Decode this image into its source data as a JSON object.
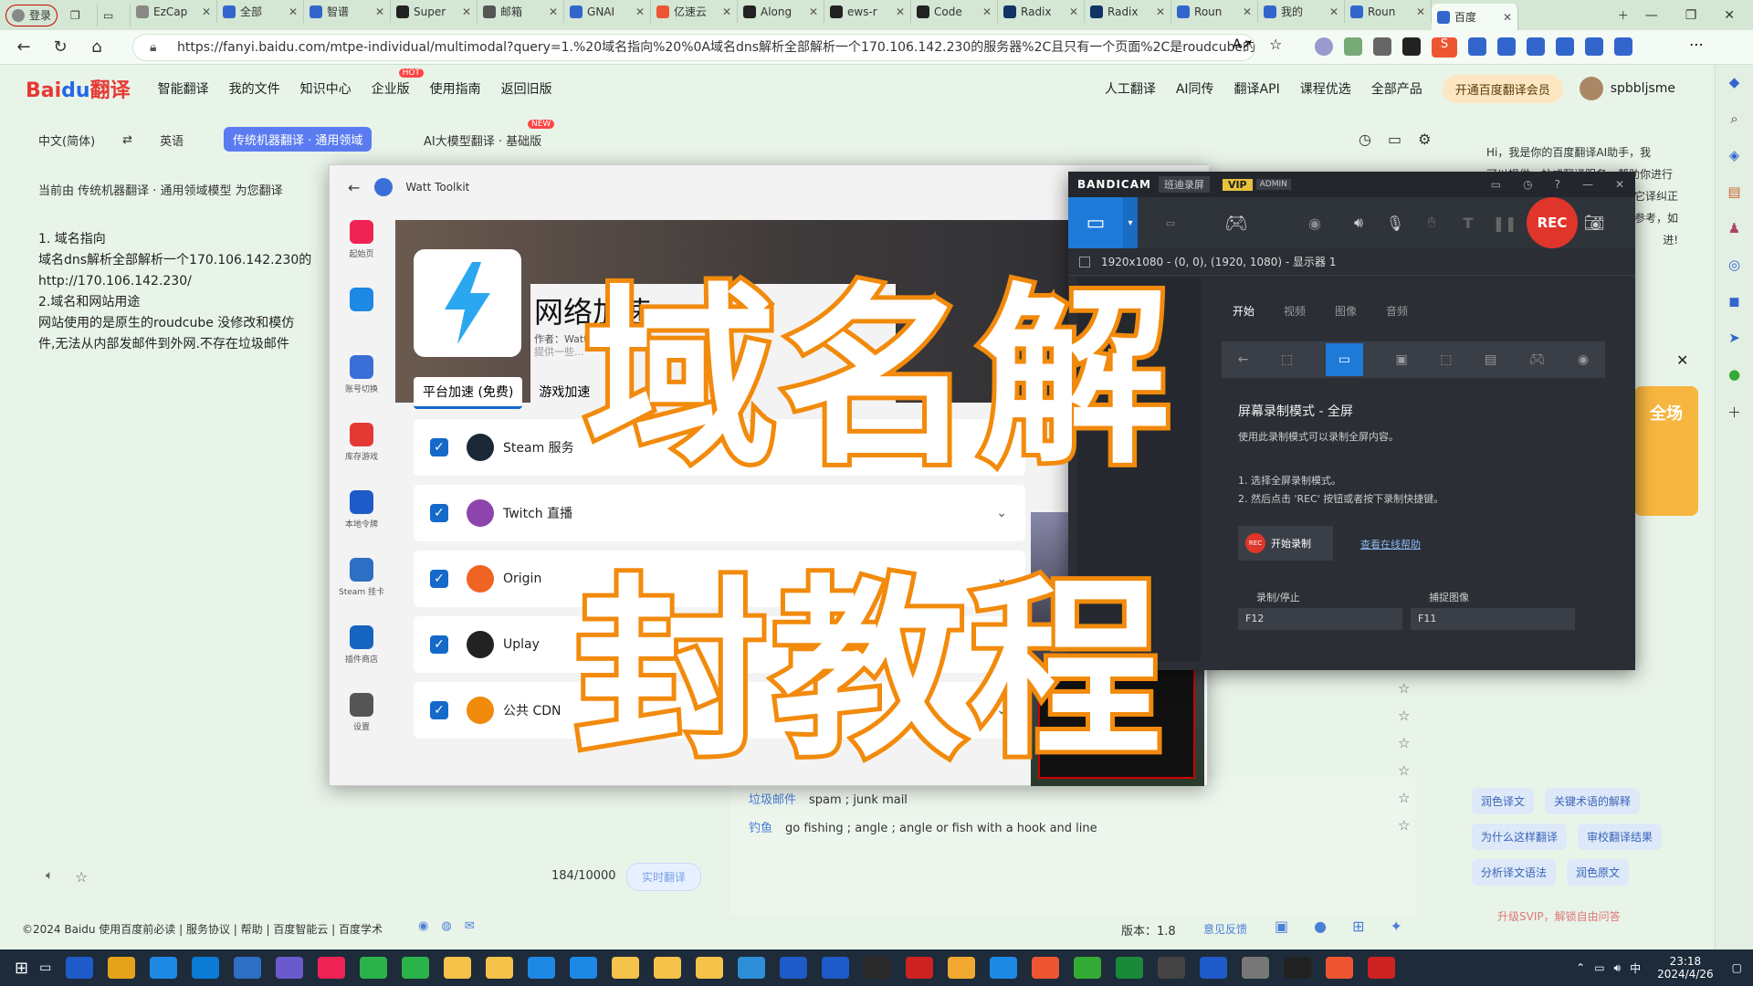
{
  "browser": {
    "login_label": "登录",
    "tabs": [
      "EzCap",
      "全部",
      "智谱",
      "Super",
      "邮箱",
      "GNAI",
      "亿速云",
      "Along",
      "ews-r",
      "Code",
      "Radix",
      "Radix",
      "Roun",
      "我的",
      "Roun",
      "百度"
    ],
    "url": "https://fanyi.baidu.com/mtpe-individual/multimodal?query=1.%20域名指向%20%0A域名dns解析全部解析一个170.106.142.230的服务器%2C且只有一个页面%2C是roudcube的邮箱页面..."
  },
  "baidu": {
    "logo_a": "Bai",
    "logo_b": "du",
    "logo_c": "翻译",
    "nav": [
      "智能翻译",
      "我的文件",
      "知识中心",
      "企业版",
      "使用指南",
      "返回旧版"
    ],
    "hot_badge": "HOT",
    "new_badge": "NEW",
    "nav_right": [
      "人工翻译",
      "AI同传",
      "翻译API",
      "课程优选",
      "全部产品"
    ],
    "vip_btn": "开通百度翻译会员",
    "username": "spbbljsme",
    "src_lang": "中文(简体)",
    "tgt_lang": "英语",
    "mode_active": "传统机器翻译 · 通用领域",
    "mode_ai": "AI大模型翻译 · 基础版",
    "current_model": "当前由 传统机器翻译 · 通用领域模型 为您翻译",
    "source_text": [
      "1. 域名指向",
      "域名dns解析全部解析一个170.106.142.230的",
      "http://170.106.142.230/",
      "2.域名和网站用途",
      "网站使用的是原生的roudcube 没修改和模仿",
      "件,无法从内部发邮件到外网.不存在垃圾邮件"
    ],
    "char_count": "184/10000",
    "realtime_btn": "实时翻译",
    "dict": [
      {
        "term": "垃圾邮件",
        "def": "spam ; junk mail"
      },
      {
        "term": "钓鱼",
        "def": "go fishing ; angle ; angle or fish with a hook and line"
      }
    ],
    "assistant_text": [
      "Hi，我是你的百度翻译AI助手，我",
      "可以提供一站式翻译服务，帮助你进行",
      "它译纠正",
      "参考，如",
      "进!"
    ],
    "side_chips": [
      "润色译文",
      "关键术语的解释",
      "为什么这样翻译",
      "审校翻译结果",
      "分析译文语法",
      "润色原文"
    ],
    "footer_left": "©2024 Baidu  使用百度前必读 | 服务协议 | 帮助 | 百度智能云 | 百度学术",
    "version": "版本：1.8",
    "feedback": "意见反馈",
    "svip": "升级SVIP，解锁自由问答"
  },
  "watt": {
    "title": "Watt Toolkit",
    "header": "网络加速",
    "author": "作者：Watt To",
    "hint": "提供一些...",
    "tab_platform": "平台加速 (免费)",
    "tab_game": "游戏加速",
    "sidebar": [
      "起始页",
      "",
      "账号切换",
      "库存游戏",
      "本地令牌",
      "Steam 挂卡",
      "插件商店",
      "设置"
    ],
    "services": [
      "Steam 服务",
      "Twitch 直播",
      "Origin",
      "Uplay",
      "公共 CDN"
    ]
  },
  "bandicam": {
    "brand": "BANDICAM",
    "mode": "班迪录屏",
    "vip": "VIP",
    "admin": "ADMIN",
    "rec": "REC",
    "resolution": "1920x1080 - (0, 0), (1920, 1080) - 显示器 1",
    "tabs": [
      "开始",
      "视频",
      "图像",
      "音频"
    ],
    "mode_title": "屏幕录制模式 - 全屏",
    "mode_desc": "使用此录制模式可以录制全屏内容。",
    "step1": "1. 选择全屏录制模式。",
    "step2": "2. 然后点击 'REC' 按钮或者按下录制快捷键。",
    "start_btn": "开始录制",
    "help_link": "查看在线帮助",
    "hotkey_rec_label": "录制/停止",
    "hotkey_rec": "F12",
    "hotkey_cap_label": "捕捉图像",
    "hotkey_cap": "F11"
  },
  "overlay": {
    "line1": "域名解",
    "line2": "封教程"
  },
  "taskbar": {
    "time": "23:18",
    "date": "2024/4/26",
    "lang": "中"
  }
}
